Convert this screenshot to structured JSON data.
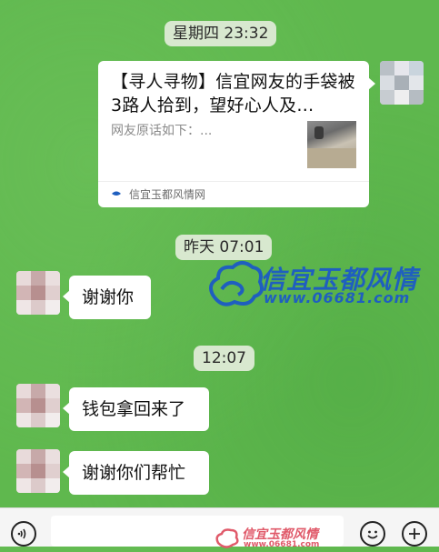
{
  "timestamps": [
    "星期四 23:32",
    "昨天 07:01",
    "12:07"
  ],
  "card": {
    "title": "【寻人寻物】信宜网友的手袋被3路人拾到，望好心人及…",
    "desc": "网友原话如下：...",
    "source": "信宜玉都风情网"
  },
  "messages": [
    {
      "text": "谢谢你"
    },
    {
      "text": "钱包拿回来了"
    },
    {
      "text": "谢谢你们帮忙"
    }
  ],
  "watermark": {
    "name": "信宜玉都风情",
    "url": "www.06681.com"
  },
  "bottom_watermark": {
    "name": "信宜玉都风情",
    "url": "www.06681.com"
  },
  "icons": {
    "voice": "voice-icon",
    "emoji": "emoji-icon",
    "plus": "plus-icon"
  },
  "colors": {
    "chat_bg": "#5fb84e",
    "bubble": "#ffffff",
    "watermark_blue": "#1f5fbf",
    "watermark_red": "#e05a6a"
  }
}
